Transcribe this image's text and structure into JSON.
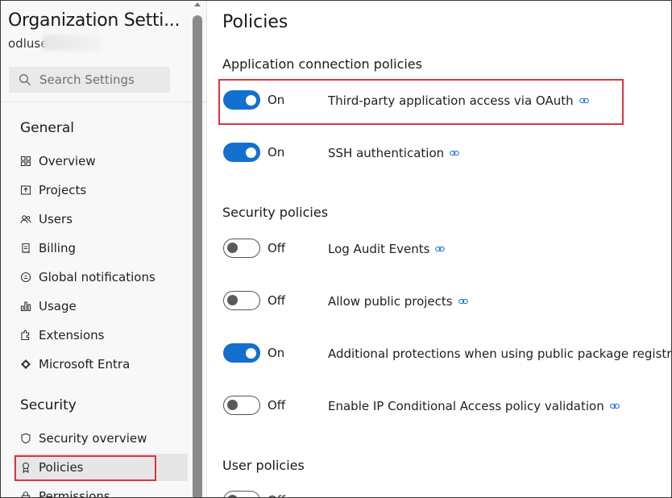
{
  "sidebar": {
    "org_title": "Organization Setti...",
    "org_user": "odluse",
    "search": {
      "placeholder": "Search Settings",
      "icon": "search-icon"
    },
    "sections": [
      {
        "title": "General",
        "items": [
          {
            "label": "Overview",
            "icon": "overview-icon"
          },
          {
            "label": "Projects",
            "icon": "projects-icon"
          },
          {
            "label": "Users",
            "icon": "users-icon"
          },
          {
            "label": "Billing",
            "icon": "billing-icon"
          },
          {
            "label": "Global notifications",
            "icon": "notifications-icon"
          },
          {
            "label": "Usage",
            "icon": "usage-icon"
          },
          {
            "label": "Extensions",
            "icon": "extensions-icon"
          },
          {
            "label": "Microsoft Entra",
            "icon": "entra-icon"
          }
        ]
      },
      {
        "title": "Security",
        "items": [
          {
            "label": "Security overview",
            "icon": "shield-icon"
          },
          {
            "label": "Policies",
            "icon": "policy-icon",
            "active": true
          },
          {
            "label": "Permissions",
            "icon": "lock-icon"
          }
        ]
      }
    ]
  },
  "main": {
    "title": "Policies",
    "groups": [
      {
        "title": "Application connection policies",
        "policies": [
          {
            "state": "On",
            "label": "Third-party application access via OAuth"
          },
          {
            "state": "On",
            "label": "SSH authentication"
          }
        ]
      },
      {
        "title": "Security policies",
        "policies": [
          {
            "state": "Off",
            "label": "Log Audit Events"
          },
          {
            "state": "Off",
            "label": "Allow public projects"
          },
          {
            "state": "On",
            "label": "Additional protections when using public package registries"
          },
          {
            "state": "Off",
            "label": "Enable IP Conditional Access policy validation"
          }
        ]
      },
      {
        "title": "User policies",
        "policies": [
          {
            "state": "Off",
            "label": ""
          }
        ]
      }
    ]
  },
  "colors": {
    "accent": "#1370cf",
    "highlight": "#d9363e"
  }
}
